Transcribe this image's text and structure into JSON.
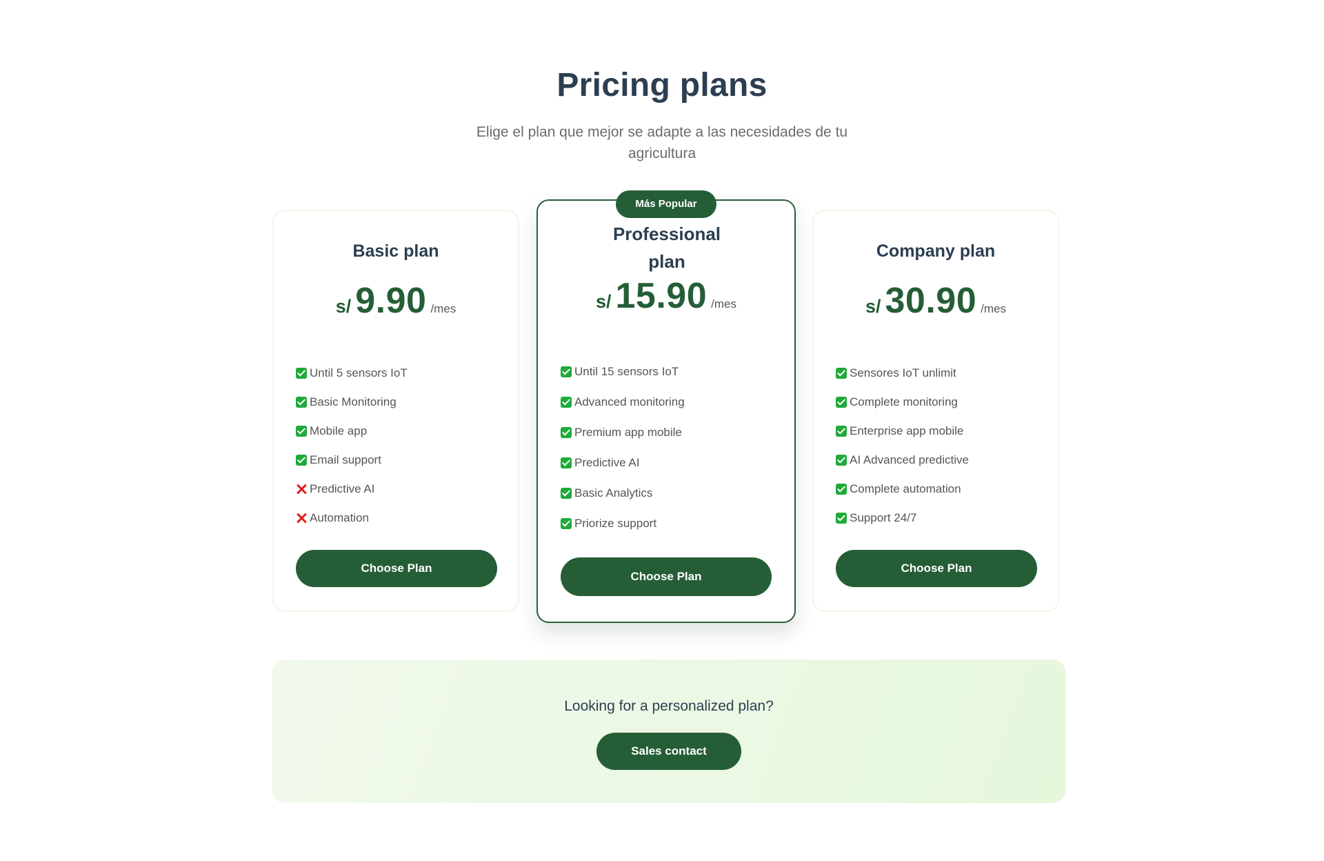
{
  "header": {
    "title": "Pricing plans",
    "subtitle": "Elige el plan que mejor se adapte a las necesidades de tu agricultura"
  },
  "plans": [
    {
      "name": "Basic plan",
      "currency": "s/",
      "amount": "9.90",
      "period": "/mes",
      "features": [
        {
          "icon": "check-icon",
          "text": "Until 5 sensors IoT"
        },
        {
          "icon": "check-icon",
          "text": "Basic Monitoring"
        },
        {
          "icon": "check-icon",
          "text": "Mobile app"
        },
        {
          "icon": "check-icon",
          "text": "Email support"
        },
        {
          "icon": "cross-icon",
          "text": "Predictive AI"
        },
        {
          "icon": "cross-icon",
          "text": "Automation"
        }
      ],
      "button": "Choose Plan"
    },
    {
      "name": "Professional plan",
      "badge": "Más Popular",
      "currency": "s/",
      "amount": "15.90",
      "period": "/mes",
      "features": [
        {
          "icon": "check-icon",
          "text": "Until 15 sensors IoT"
        },
        {
          "icon": "check-icon",
          "text": "Advanced monitoring"
        },
        {
          "icon": "check-icon",
          "text": "Premium app mobile"
        },
        {
          "icon": "check-icon",
          "text": "Predictive AI"
        },
        {
          "icon": "check-icon",
          "text": "Basic Analytics"
        },
        {
          "icon": "check-icon",
          "text": "Priorize support"
        }
      ],
      "button": "Choose Plan"
    },
    {
      "name": "Company plan",
      "currency": "s/",
      "amount": "30.90",
      "period": "/mes",
      "features": [
        {
          "icon": "check-icon",
          "text": "Sensores IoT unlimit"
        },
        {
          "icon": "check-icon",
          "text": "Complete monitoring"
        },
        {
          "icon": "check-icon",
          "text": "Enterprise app mobile"
        },
        {
          "icon": "check-icon",
          "text": "AI Advanced predictive"
        },
        {
          "icon": "check-icon",
          "text": "Complete automation"
        },
        {
          "icon": "check-icon",
          "text": "Support 24/7"
        }
      ],
      "button": "Choose Plan"
    }
  ],
  "cta": {
    "text": "Looking for a personalized plan?",
    "button": "Sales contact"
  },
  "colors": {
    "brand_green": "#255e36",
    "heading": "#2c3e50",
    "check": "#1faa3a",
    "cross": "#e01b1b",
    "cta_background": "#ebf8e3"
  }
}
